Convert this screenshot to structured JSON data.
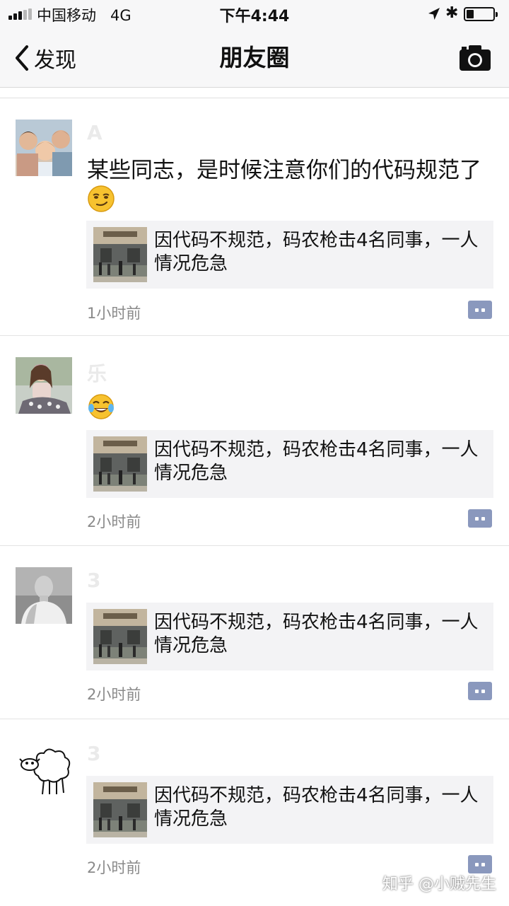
{
  "status_bar": {
    "carrier": "中国移动",
    "network": "4G",
    "time": "下午4:44",
    "signal_bars_filled": 3,
    "signal_bars_total": 5,
    "battery_level": 0.2
  },
  "nav": {
    "back_label": "发现",
    "title": "朋友圈",
    "icons": [
      "chevron-left-icon",
      "camera-icon"
    ]
  },
  "posts": [
    {
      "name": "A",
      "text": "某些同志，是时候注意你们的代码规范了",
      "emoji": "smirk-emoji",
      "link_title": "因代码不规范，码农枪击4名同事，一人情况危急",
      "time": "1小时前"
    },
    {
      "name": "乐",
      "text": "",
      "emoji": "tears-of-joy-emoji",
      "link_title": "因代码不规范，码农枪击4名同事，一人情况危急",
      "time": "2小时前"
    },
    {
      "name": "3",
      "text": "",
      "emoji": "",
      "link_title": "因代码不规范，码农枪击4名同事，一人情况危急",
      "time": "2小时前"
    },
    {
      "name": "3",
      "text": "",
      "emoji": "",
      "link_title": "因代码不规范，码农枪击4名同事，一人情况危急",
      "time": "2小时前"
    }
  ],
  "watermark": "知乎 @小贼先生",
  "colors": {
    "background": "#ffffff",
    "nav_bar": "#f7f7f8",
    "link_card": "#f3f3f5",
    "comment_button": "#8a98bd",
    "time_text": "#8a8a8a"
  }
}
